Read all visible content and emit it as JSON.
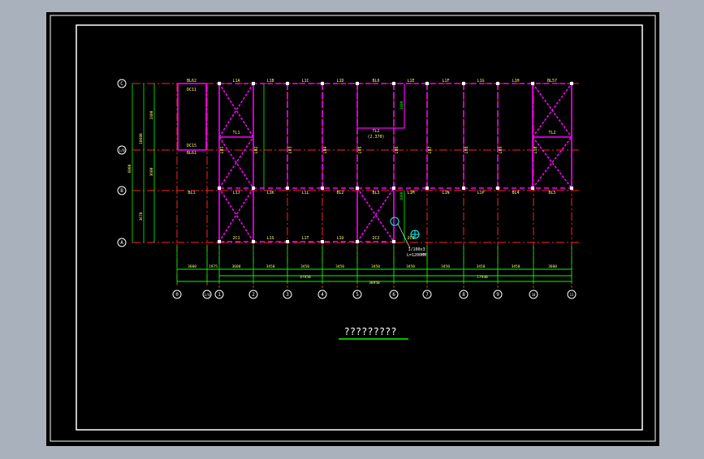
{
  "drawing": {
    "title": "?????????",
    "colors": {
      "frame": "#ffffff",
      "beam": "#ff00ff",
      "column_grid": "#ff2222",
      "dimension": "#00ff00",
      "text": "#ffff66",
      "bubble": "#ffffff",
      "accent": "#00ffff"
    }
  },
  "axes": {
    "horizontal": [
      {
        "label": "C"
      },
      {
        "label": "1/B"
      },
      {
        "label": "B"
      },
      {
        "label": "A"
      }
    ],
    "vertical": [
      {
        "label": "0"
      },
      {
        "label": "1/0"
      },
      {
        "label": "1"
      },
      {
        "label": "2"
      },
      {
        "label": "3"
      },
      {
        "label": "4"
      },
      {
        "label": "5"
      },
      {
        "label": "6"
      },
      {
        "label": "7"
      },
      {
        "label": "8"
      },
      {
        "label": "9"
      },
      {
        "label": "10"
      },
      {
        "label": "11"
      }
    ]
  },
  "dimensions": {
    "bays": [
      "3600",
      "1975",
      "3600",
      "3450",
      "3450",
      "3450",
      "3450",
      "3450",
      "3450",
      "3450",
      "3450",
      "3600"
    ],
    "subtotal_left": "47950",
    "subtotal_right": "17940",
    "overall": "38950",
    "left_side": [
      "2400",
      "10600",
      "3600",
      "6000",
      "3670"
    ]
  },
  "beam_labels": {
    "top_row": [
      "BL62",
      "L1A",
      "L1B",
      "L1C",
      "L1D",
      "BL6",
      "L1E",
      "L1F",
      "L1G",
      "L1H",
      "BL57"
    ],
    "b_row": [
      "BL1",
      "L1J",
      "L1K",
      "L1L",
      "BL2",
      "BL3",
      "L1M",
      "L1N",
      "L1P",
      "BL4",
      "BL5"
    ],
    "a_row": [
      "2C1",
      "L1S",
      "L1T",
      "L1U",
      "2C2",
      "2C3",
      "2C5",
      "2C6"
    ],
    "verticals": [
      "L01",
      "L02",
      "L03",
      "L04",
      "L05",
      "L06",
      "L07",
      "L08",
      "L09",
      "L10"
    ]
  },
  "misc_labels": {
    "dc_top": "DC11",
    "dc_mid": "DC15",
    "bl_mid": "BL61",
    "tl_center": "TL2",
    "tl_center_sub": "(2.370)",
    "tl_left": "TL1",
    "tl_right": "TL2",
    "stair_note_1": "1/100x3",
    "stair_note_2": "L=1200MM",
    "cut_dim": "2400",
    "stair_dim": "1000"
  }
}
